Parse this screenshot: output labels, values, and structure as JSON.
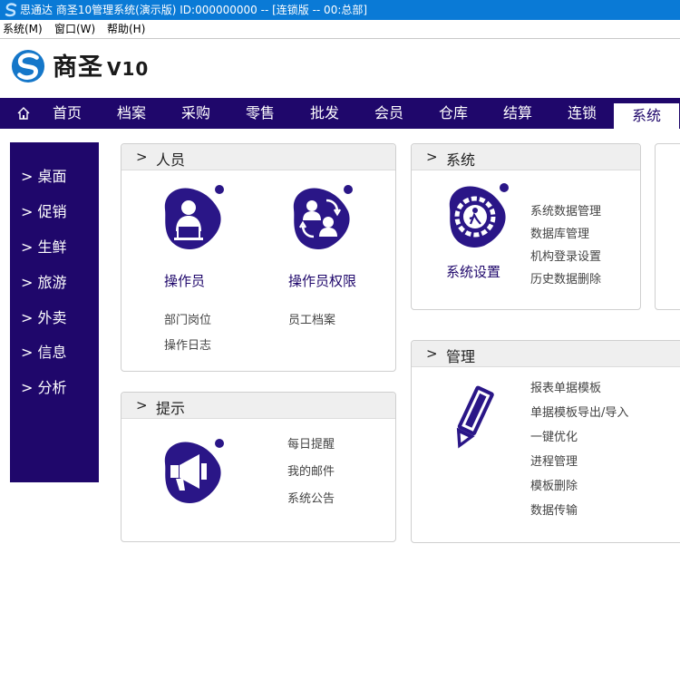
{
  "titlebar": {
    "title": "思通达 商圣10管理系统(演示版) ID:000000000 -- [连锁版 -- 00:总部]"
  },
  "menubar": {
    "items": [
      "系统(M)",
      "窗口(W)",
      "帮助(H)"
    ]
  },
  "brand": {
    "name": "商圣",
    "version": "V10"
  },
  "nav": {
    "items": [
      "首页",
      "档案",
      "采购",
      "零售",
      "批发",
      "会员",
      "仓库",
      "结算",
      "连锁",
      "系统"
    ],
    "active": "系统"
  },
  "sidebar": {
    "items": [
      "> 桌面",
      "> 促销",
      "> 生鲜",
      "> 旅游",
      "> 外卖",
      "> 信息",
      "> 分析"
    ]
  },
  "panels": {
    "personnel": {
      "title": "人员",
      "tiles": [
        {
          "label": "操作员",
          "links": [
            "部门岗位",
            "操作日志"
          ]
        },
        {
          "label": "操作员权限",
          "links": [
            "员工档案"
          ]
        }
      ]
    },
    "system": {
      "title": "系统",
      "tile_label": "系统设置",
      "links": [
        "系统数据管理",
        "数据库管理",
        "机构登录设置",
        "历史数据删除"
      ]
    },
    "tips": {
      "title": "提示",
      "links": [
        "每日提醒",
        "我的邮件",
        "系统公告"
      ]
    },
    "management": {
      "title": "管理",
      "links": [
        "报表单据模板",
        "单据模板导出/导入",
        "一键优化",
        "进程管理",
        "模板删除",
        "数据传输"
      ]
    }
  },
  "colors": {
    "navy": "#1f076b",
    "icon_blob": "#2a1687",
    "titlebar": "#0a7ad6"
  }
}
